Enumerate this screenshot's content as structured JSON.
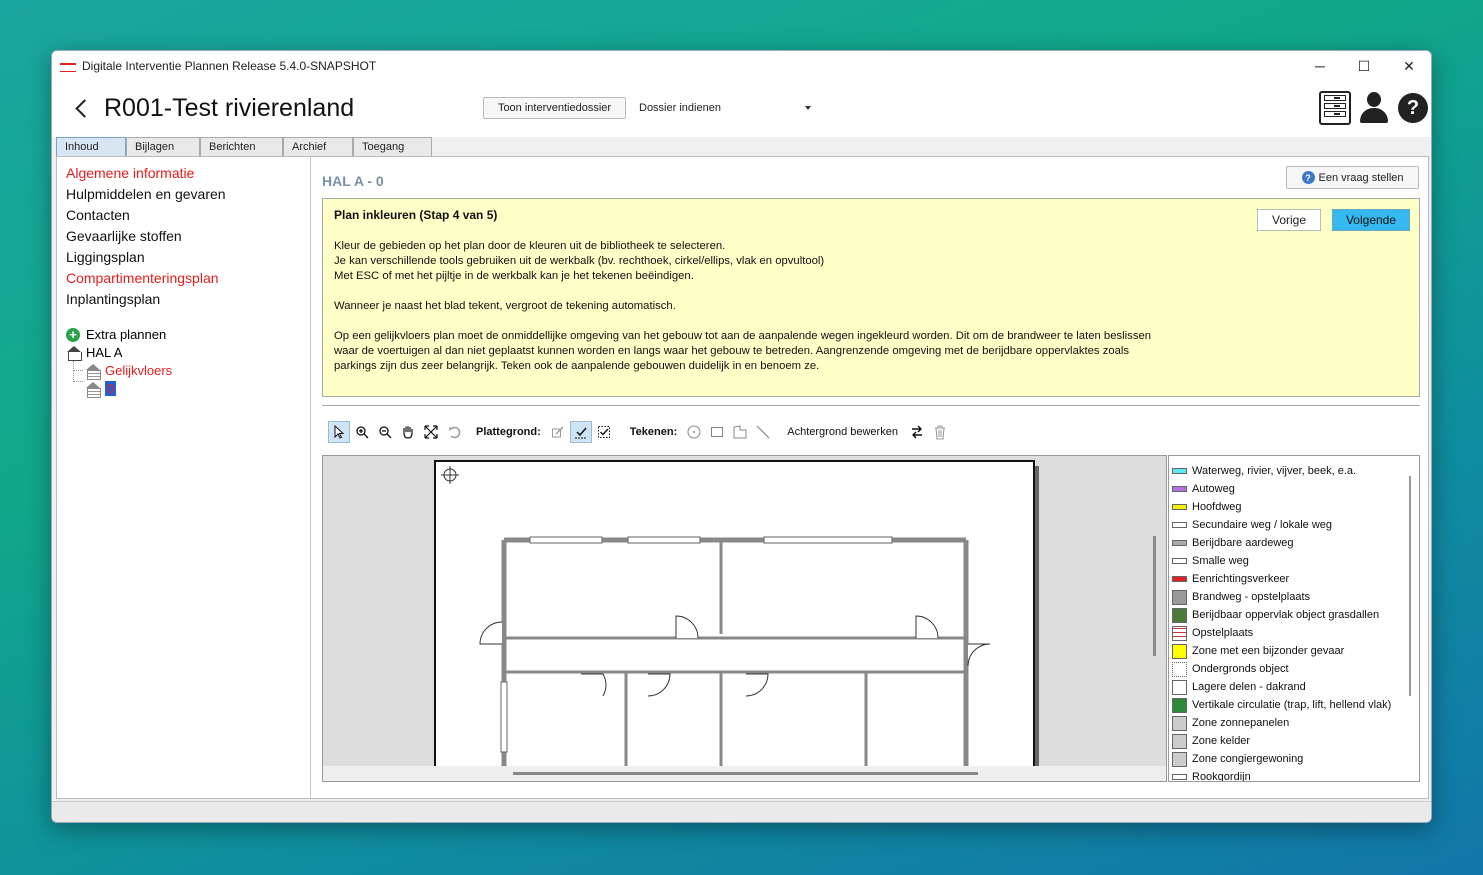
{
  "window": {
    "title": "Digitale Interventie Plannen Release 5.4.0-SNAPSHOT",
    "controls": {
      "minimize": "─",
      "maximize": "☐",
      "close": "✕"
    }
  },
  "header": {
    "title": "R001-Test rivierenland",
    "toon_button": "Toon interventiedossier",
    "dossier_select": "Dossier indienen",
    "help_label": "?"
  },
  "tabs": [
    "Inhoud",
    "Bijlagen",
    "Berichten",
    "Archief",
    "Toegang"
  ],
  "sidebar": {
    "items": [
      {
        "label": "Algemene informatie",
        "color": "#e51c1c"
      },
      {
        "label": "Hulpmiddelen en gevaren",
        "color": "#111111"
      },
      {
        "label": "Contacten",
        "color": "#111111"
      },
      {
        "label": "Gevaarlijke stoffen",
        "color": "#111111"
      },
      {
        "label": "Liggingsplan",
        "color": "#111111"
      },
      {
        "label": "Compartimenteringsplan",
        "color": "#e51c1c"
      },
      {
        "label": "Inplantingsplan",
        "color": "#111111"
      }
    ],
    "tree": {
      "extra": "Extra plannen",
      "hal": "HAL A",
      "gelijkvloers": "Gelijkvloers",
      "floor": "0"
    }
  },
  "content": {
    "title": "HAL A - 0",
    "vraag_button": "Een vraag stellen",
    "step": {
      "title": "Plan inkleuren (Stap 4 van 5)",
      "text": "Kleur de gebieden op het plan door de kleuren uit de bibliotheek te selecteren.\nJe kan verschillende tools gebruiken uit de werkbalk (bv. rechthoek, cirkel/ellips, vlak en opvultool)\nMet ESC of met het pijltje in de werkbalk kan je het tekenen beëindigen.\n\nWanneer je naast het blad tekent, vergroot de tekening automatisch.\n\nOp een gelijkvloers plan moet de onmiddellijke omgeving van het gebouw tot aan de aanpalende wegen ingekleurd worden. Dit om de brandweer te laten beslissen\nwaar de voertuigen al dan niet geplaatst kunnen worden en langs waar het gebouw te betreden. Aangrenzende omgeving met de berijdbare oppervlaktes zoals\nparkings zijn dus zeer belangrijk. Teken ook de aanpalende gebouwen duidelijk in en benoem ze.",
      "vorige": "Vorige",
      "volgende": "Volgende"
    },
    "toolbar": {
      "plattegrond_label": "Plattegrond:",
      "tekenen_label": "Tekenen:",
      "achtergrond_label": "Achtergrond bewerken"
    },
    "legend": [
      {
        "label": "Waterweg, rivier, vijver, beek, e.a.",
        "color": "#5fe8f0",
        "thin": true
      },
      {
        "label": "Autoweg",
        "color": "#b070e0",
        "thin": true
      },
      {
        "label": "Hoofdweg",
        "color": "#f0f000",
        "thin": true
      },
      {
        "label": "Secundaire weg / lokale weg",
        "color": "#ffffff",
        "thin": true
      },
      {
        "label": "Berijdbare aardeweg",
        "color": "#aaaaaa",
        "thin": true
      },
      {
        "label": "Smalle weg",
        "color": "#ffffff",
        "thin": true
      },
      {
        "label": "Eenrichtingsverkeer",
        "color": "#e02020",
        "thin": true
      },
      {
        "label": "Brandweg - opstelplaats",
        "color": "#9a9a9a",
        "thin": false
      },
      {
        "label": "Berijdbaar oppervlak object grasdallen",
        "color": "#4a7a3a",
        "thin": false
      },
      {
        "label": "Opstelplaats",
        "color": "#ffffff",
        "thin": false
      },
      {
        "label": "Zone met een bijzonder gevaar",
        "color": "#ffff00",
        "thin": false
      },
      {
        "label": "Ondergronds object",
        "color": "#ffffff",
        "thin": false
      },
      {
        "label": "Lagere delen - dakrand",
        "color": "#ffffff",
        "thin": false
      },
      {
        "label": "Vertikale circulatie (trap, lift, hellend vlak)",
        "color": "#2a8a3a",
        "thin": false
      },
      {
        "label": "Zone zonnepanelen",
        "color": "#cccccc",
        "thin": false
      },
      {
        "label": "Zone kelder",
        "color": "#cccccc",
        "thin": false
      },
      {
        "label": "Zone congiergewoning",
        "color": "#cccccc",
        "thin": false
      },
      {
        "label": "Rookgordijn",
        "color": "#ffffff",
        "thin": true
      }
    ]
  }
}
